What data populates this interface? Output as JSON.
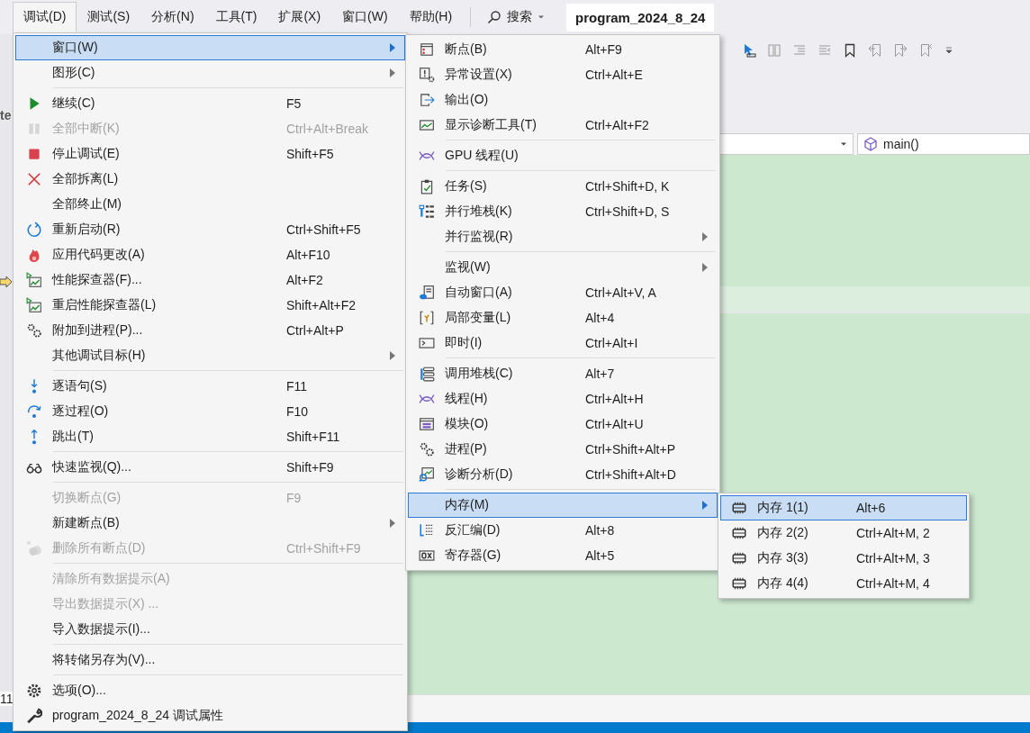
{
  "menu_bar": {
    "items": [
      {
        "label": "调试(D)",
        "selected": true
      },
      {
        "label": "测试(S)",
        "selected": false
      },
      {
        "label": "分析(N)",
        "selected": false
      },
      {
        "label": "工具(T)",
        "selected": false
      },
      {
        "label": "扩展(X)",
        "selected": false
      },
      {
        "label": "窗口(W)",
        "selected": false
      },
      {
        "label": "帮助(H)",
        "selected": false
      }
    ],
    "search": {
      "label": "搜索"
    },
    "title": "program_2024_8_24"
  },
  "editor": {
    "tab_fragment": "te",
    "line_fragment": "11",
    "function_combo": "main()"
  },
  "debug_menu": {
    "items": [
      {
        "kind": "item",
        "label": "窗口(W)",
        "submenu": true,
        "selected": true,
        "disabled": false
      },
      {
        "kind": "item",
        "label": "图形(C)",
        "submenu": true,
        "selected": false,
        "disabled": false
      },
      {
        "kind": "separator"
      },
      {
        "kind": "item",
        "label": "继续(C)",
        "shortcut": "F5",
        "submenu": false,
        "selected": false,
        "disabled": false
      },
      {
        "kind": "item",
        "label": "全部中断(K)",
        "shortcut": "Ctrl+Alt+Break",
        "submenu": false,
        "selected": false,
        "disabled": true
      },
      {
        "kind": "item",
        "label": "停止调试(E)",
        "shortcut": "Shift+F5",
        "submenu": false,
        "selected": false,
        "disabled": false
      },
      {
        "kind": "item",
        "label": "全部拆离(L)",
        "submenu": false,
        "selected": false,
        "disabled": false
      },
      {
        "kind": "item",
        "label": "全部终止(M)",
        "submenu": false,
        "selected": false,
        "disabled": false
      },
      {
        "kind": "item",
        "label": "重新启动(R)",
        "shortcut": "Ctrl+Shift+F5",
        "submenu": false,
        "selected": false,
        "disabled": false
      },
      {
        "kind": "item",
        "label": "应用代码更改(A)",
        "shortcut": "Alt+F10",
        "submenu": false,
        "selected": false,
        "disabled": false
      },
      {
        "kind": "item",
        "label": "性能探查器(F)...",
        "shortcut": "Alt+F2",
        "submenu": false,
        "selected": false,
        "disabled": false
      },
      {
        "kind": "item",
        "label": "重启性能探查器(L)",
        "shortcut": "Shift+Alt+F2",
        "submenu": false,
        "selected": false,
        "disabled": false
      },
      {
        "kind": "item",
        "label": "附加到进程(P)...",
        "shortcut": "Ctrl+Alt+P",
        "submenu": false,
        "selected": false,
        "disabled": false
      },
      {
        "kind": "item",
        "label": "其他调试目标(H)",
        "submenu": true,
        "selected": false,
        "disabled": false
      },
      {
        "kind": "separator"
      },
      {
        "kind": "item",
        "label": "逐语句(S)",
        "shortcut": "F11",
        "submenu": false,
        "selected": false,
        "disabled": false
      },
      {
        "kind": "item",
        "label": "逐过程(O)",
        "shortcut": "F10",
        "submenu": false,
        "selected": false,
        "disabled": false
      },
      {
        "kind": "item",
        "label": "跳出(T)",
        "shortcut": "Shift+F11",
        "submenu": false,
        "selected": false,
        "disabled": false
      },
      {
        "kind": "separator"
      },
      {
        "kind": "item",
        "label": "快速监视(Q)...",
        "shortcut": "Shift+F9",
        "submenu": false,
        "selected": false,
        "disabled": false
      },
      {
        "kind": "separator"
      },
      {
        "kind": "item",
        "label": "切换断点(G)",
        "shortcut": "F9",
        "submenu": false,
        "selected": false,
        "disabled": true
      },
      {
        "kind": "item",
        "label": "新建断点(B)",
        "submenu": true,
        "selected": false,
        "disabled": false
      },
      {
        "kind": "item",
        "label": "删除所有断点(D)",
        "shortcut": "Ctrl+Shift+F9",
        "submenu": false,
        "selected": false,
        "disabled": true
      },
      {
        "kind": "separator"
      },
      {
        "kind": "item",
        "label": "清除所有数据提示(A)",
        "submenu": false,
        "selected": false,
        "disabled": true
      },
      {
        "kind": "item",
        "label": "导出数据提示(X) ...",
        "submenu": false,
        "selected": false,
        "disabled": true
      },
      {
        "kind": "item",
        "label": "导入数据提示(I)...",
        "submenu": false,
        "selected": false,
        "disabled": false
      },
      {
        "kind": "separator"
      },
      {
        "kind": "item",
        "label": "将转储另存为(V)...",
        "submenu": false,
        "selected": false,
        "disabled": false
      },
      {
        "kind": "separator"
      },
      {
        "kind": "item",
        "label": "选项(O)...",
        "submenu": false,
        "selected": false,
        "disabled": false
      },
      {
        "kind": "item",
        "label": "program_2024_8_24 调试属性",
        "submenu": false,
        "selected": false,
        "disabled": false
      }
    ]
  },
  "windows_submenu": {
    "items": [
      {
        "kind": "item",
        "label": "断点(B)",
        "shortcut": "Alt+F9",
        "submenu": false,
        "selected": false
      },
      {
        "kind": "item",
        "label": "异常设置(X)",
        "shortcut": "Ctrl+Alt+E",
        "submenu": false,
        "selected": false
      },
      {
        "kind": "item",
        "label": "输出(O)",
        "submenu": false,
        "selected": false
      },
      {
        "kind": "item",
        "label": "显示诊断工具(T)",
        "shortcut": "Ctrl+Alt+F2",
        "submenu": false,
        "selected": false
      },
      {
        "kind": "separator"
      },
      {
        "kind": "item",
        "label": "GPU 线程(U)",
        "submenu": false,
        "selected": false
      },
      {
        "kind": "separator"
      },
      {
        "kind": "item",
        "label": "任务(S)",
        "shortcut": "Ctrl+Shift+D, K",
        "submenu": false,
        "selected": false
      },
      {
        "kind": "item",
        "label": "并行堆栈(K)",
        "shortcut": "Ctrl+Shift+D, S",
        "submenu": false,
        "selected": false
      },
      {
        "kind": "item",
        "label": "并行监视(R)",
        "submenu": true,
        "selected": false
      },
      {
        "kind": "separator"
      },
      {
        "kind": "item",
        "label": "监视(W)",
        "submenu": true,
        "selected": false
      },
      {
        "kind": "item",
        "label": "自动窗口(A)",
        "shortcut": "Ctrl+Alt+V, A",
        "submenu": false,
        "selected": false
      },
      {
        "kind": "item",
        "label": "局部变量(L)",
        "shortcut": "Alt+4",
        "submenu": false,
        "selected": false
      },
      {
        "kind": "item",
        "label": "即时(I)",
        "shortcut": "Ctrl+Alt+I",
        "submenu": false,
        "selected": false
      },
      {
        "kind": "separator"
      },
      {
        "kind": "item",
        "label": "调用堆栈(C)",
        "shortcut": "Alt+7",
        "submenu": false,
        "selected": false
      },
      {
        "kind": "item",
        "label": "线程(H)",
        "shortcut": "Ctrl+Alt+H",
        "submenu": false,
        "selected": false
      },
      {
        "kind": "item",
        "label": "模块(O)",
        "shortcut": "Ctrl+Alt+U",
        "submenu": false,
        "selected": false
      },
      {
        "kind": "item",
        "label": "进程(P)",
        "shortcut": "Ctrl+Shift+Alt+P",
        "submenu": false,
        "selected": false
      },
      {
        "kind": "item",
        "label": "诊断分析(D)",
        "shortcut": "Ctrl+Shift+Alt+D",
        "submenu": false,
        "selected": false
      },
      {
        "kind": "separator"
      },
      {
        "kind": "item",
        "label": "内存(M)",
        "submenu": true,
        "selected": true
      },
      {
        "kind": "item",
        "label": "反汇编(D)",
        "shortcut": "Alt+8",
        "submenu": false,
        "selected": false
      },
      {
        "kind": "item",
        "label": "寄存器(G)",
        "shortcut": "Alt+5",
        "submenu": false,
        "selected": false
      }
    ]
  },
  "memory_submenu": {
    "items": [
      {
        "label": "内存 1(1)",
        "shortcut": "Alt+6",
        "selected": true
      },
      {
        "label": "内存 2(2)",
        "shortcut": "Ctrl+Alt+M, 2",
        "selected": false
      },
      {
        "label": "内存 3(3)",
        "shortcut": "Ctrl+Alt+M, 3",
        "selected": false
      },
      {
        "label": "内存 4(4)",
        "shortcut": "Ctrl+Alt+M, 4",
        "selected": false
      }
    ]
  }
}
